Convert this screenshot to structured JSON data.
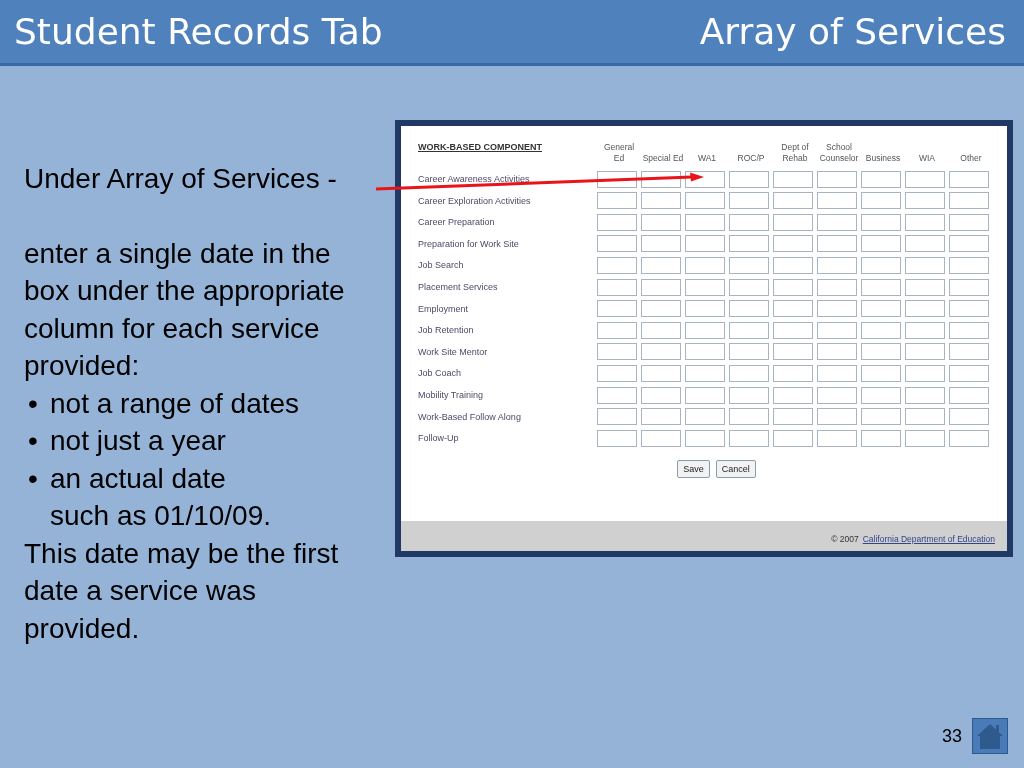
{
  "slide": {
    "title": "Student Records Tab",
    "section": "Array of Services",
    "page_number": "33"
  },
  "instructions": {
    "intro": "Under Array of Services -",
    "body": "enter a single date in the box under the appropriate column for each service provided:",
    "bullets": [
      {
        "marker": "•",
        "lines": [
          "not a range of dates"
        ]
      },
      {
        "marker": "•",
        "lines": [
          "not just a year"
        ]
      },
      {
        "marker": "•",
        "lines": [
          "an actual date",
          "such as 01/10/09."
        ]
      }
    ],
    "note": "This date may be the first date a service was provided."
  },
  "form": {
    "heading": "WORK-BASED COMPONENT",
    "columns": [
      [
        "General",
        "Ed"
      ],
      [
        "Special Ed"
      ],
      [
        "WA1"
      ],
      [
        "ROC/P"
      ],
      [
        "Dept of",
        "Rehab"
      ],
      [
        "School",
        "Counselor"
      ],
      [
        "Business"
      ],
      [
        "WIA"
      ],
      [
        "Other"
      ]
    ],
    "rows": [
      "Career Awareness Activities",
      "Career Exploration Activities",
      "Career Preparation",
      "Preparation for Work Site",
      "Job Search",
      "Placement Services",
      "Employment",
      "Job Retention",
      "Work Site Mentor",
      "Job Coach",
      "Mobility Training",
      "Work-Based Follow Along",
      "Follow-Up"
    ],
    "buttons": [
      "Save",
      "Cancel"
    ],
    "footer": {
      "copyright": "© 2007",
      "link": "California Department of Education"
    }
  }
}
